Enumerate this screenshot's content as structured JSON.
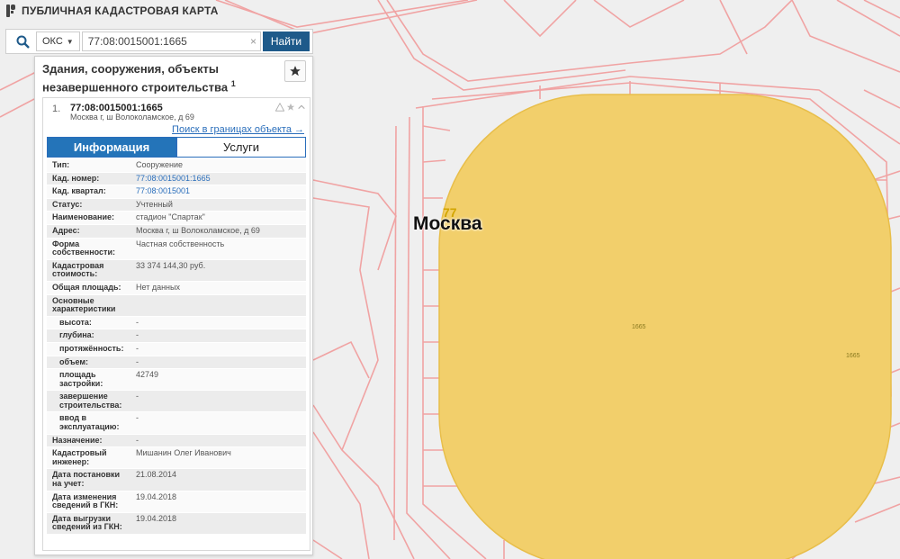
{
  "app": {
    "title": "ПУБЛИЧНАЯ КАДАСТРОВАЯ КАРТА"
  },
  "search": {
    "type_selected": "ОКС",
    "value": "77:08:0015001:1665",
    "button_label": "Найти",
    "clear_glyph": "×"
  },
  "panel": {
    "title": "Здания, сооружения, объекты незавершенного строительства",
    "title_count": "1",
    "item": {
      "number": "1.",
      "cad_number": "77:08:0015001:1665",
      "address": "Москва г, ш Волоколамское, д 69",
      "boundary_link": "Поиск в границах объекта →"
    },
    "tabs": [
      "Информация",
      "Услуги"
    ],
    "rows": [
      {
        "label": "Тип:",
        "value": "Сооружение"
      },
      {
        "label": "Кад. номер:",
        "value": "77:08:0015001:1665",
        "link": true
      },
      {
        "label": "Кад. квартал:",
        "value": "77:08:0015001",
        "link": true
      },
      {
        "label": "Статус:",
        "value": "Учтенный"
      },
      {
        "label": "Наименование:",
        "value": "стадион \"Спартак\""
      },
      {
        "label": "Адрес:",
        "value": "Москва г, ш Волоколамское, д 69"
      },
      {
        "label": "Форма собственности:",
        "value": "Частная собственность"
      },
      {
        "label": "Кадастровая стоимость:",
        "value": "33 374 144,30 руб."
      },
      {
        "label": "Общая площадь:",
        "value": "Нет данных"
      },
      {
        "label": "Основные характеристики",
        "value": ""
      },
      {
        "label": "высота:",
        "value": "-",
        "sub": true
      },
      {
        "label": "глубина:",
        "value": "-",
        "sub": true
      },
      {
        "label": "протяжённость:",
        "value": "-",
        "sub": true
      },
      {
        "label": "объем:",
        "value": "-",
        "sub": true
      },
      {
        "label": "площадь застройки:",
        "value": "42749",
        "sub": true
      },
      {
        "label": "завершение строительства:",
        "value": "-",
        "sub": true
      },
      {
        "label": "ввод в эксплуатацию:",
        "value": "-",
        "sub": true
      },
      {
        "label": "Назначение:",
        "value": "-"
      },
      {
        "label": "Кадастровый инженер:",
        "value": "Мишанин Олег Иванович"
      },
      {
        "label": "Дата постановки на учет:",
        "value": "21.08.2014"
      },
      {
        "label": "Дата изменения сведений в ГКН:",
        "value": "19.04.2018"
      },
      {
        "label": "Дата выгрузки сведений из ГКН:",
        "value": "19.04.2018"
      }
    ]
  },
  "map": {
    "city_label": "Москва",
    "region_number": "77",
    "parcel_labels": [
      "1665",
      "1665"
    ],
    "colors": {
      "parcel_fill": "#f2cf6b",
      "boundary": "#f0a3a3",
      "background": "#efefef"
    }
  }
}
